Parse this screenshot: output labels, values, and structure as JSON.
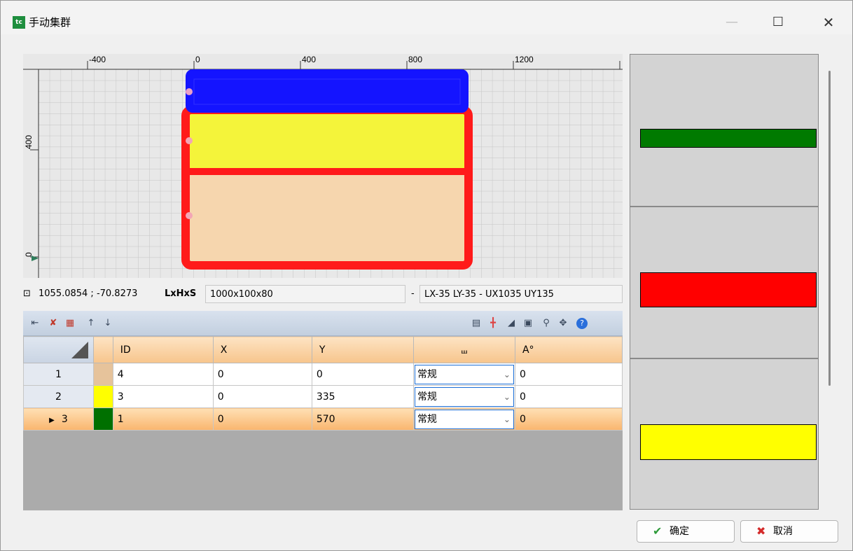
{
  "window": {
    "title": "手动集群",
    "app_icon_text": "tc"
  },
  "canvas": {
    "x_ticks": [
      "-400",
      "0",
      "400",
      "800",
      "1200"
    ],
    "y_ticks": [
      "400",
      "0"
    ],
    "colors": {
      "blue": "#1414ff",
      "yellow": "#f4f43a",
      "peach": "#f6d6ae",
      "red": "#ff1a1a",
      "grid_bg": "#e8e8e8"
    }
  },
  "status": {
    "coords": "1055.0854 ; -70.8273",
    "dims_label": "LxHxS",
    "dims_value": "1000x100x80",
    "dash": "-",
    "bounds": "LX-35 LY-35 - UX1035 UY135"
  },
  "toolbar": {
    "left_icons": [
      "align-left-icon",
      "remove-row-icon",
      "delete-table-icon",
      "move-up-icon",
      "move-down-icon"
    ],
    "right_icons": [
      "split-horizontal-icon",
      "crosshair-icon",
      "shade-icon",
      "zoom-fit-icon",
      "zoom-in-icon",
      "zoom-pan-icon",
      "help-icon"
    ]
  },
  "grid": {
    "headers": [
      "ID",
      "X",
      "Y",
      "",
      "A°"
    ],
    "rows": [
      {
        "num": "1",
        "color": "#e6c39b",
        "id": "4",
        "x": "0",
        "y": "0",
        "mode": "常规",
        "a": "0"
      },
      {
        "num": "2",
        "color": "#ffff00",
        "id": "3",
        "x": "0",
        "y": "335",
        "mode": "常规",
        "a": "0"
      },
      {
        "num": "3",
        "color": "#007000",
        "id": "1",
        "x": "0",
        "y": "570",
        "mode": "常规",
        "a": "0",
        "selected": true
      }
    ]
  },
  "side_bars": [
    {
      "color": "#007a00"
    },
    {
      "color": "#ff0000"
    },
    {
      "color": "#ffff00"
    }
  ],
  "buttons": {
    "ok": "确定",
    "cancel": "取消"
  }
}
